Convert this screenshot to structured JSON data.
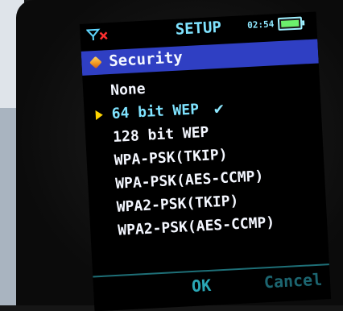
{
  "status": {
    "title": "SETUP",
    "time": "02:54",
    "signal_icon": "signal-off-icon",
    "battery_icon": "battery-icon"
  },
  "header": {
    "icon": "cube-icon",
    "label": "Security"
  },
  "menu": {
    "items": [
      {
        "label": "None"
      },
      {
        "label": "64 bit WEP",
        "selected": true,
        "checked": true
      },
      {
        "label": "128 bit WEP"
      },
      {
        "label": "WPA-PSK(TKIP)"
      },
      {
        "label": "WPA-PSK(AES-CCMP)"
      },
      {
        "label": "WPA2-PSK(TKIP)"
      },
      {
        "label": "WPA2-PSK(AES-CCMP)"
      }
    ],
    "check_glyph": "✔"
  },
  "softkeys": {
    "ok": "OK",
    "cancel": "Cancel"
  },
  "colors": {
    "header_bar": "#2f3fc3",
    "selected_text": "#7fe3ff",
    "pointer": "#ffd400",
    "softkey": "#2aa7b5"
  }
}
